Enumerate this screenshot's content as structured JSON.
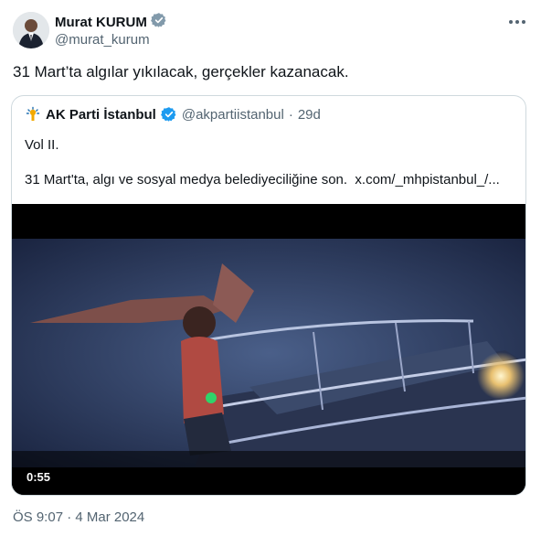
{
  "author": {
    "name": "Murat KURUM",
    "handle": "@murat_kurum",
    "verified_color": "#829aab"
  },
  "tweet": {
    "text": "31 Mart’ta algılar yıkılacak, gerçekler kazanacak.",
    "timestamp": "ÖS 9:07 · 4 Mar 2024"
  },
  "quote": {
    "name": "AK Parti İstanbul",
    "handle": "@akpartiistanbul",
    "separator": "·",
    "age": "29d",
    "text_line1": "Vol II.",
    "text_line2": "31 Mart'ta, algı ve sosyal medya belediyeciliğine son.",
    "link": "x.com/_mhpistanbul_/...",
    "verified_color": "#1d9bf0",
    "video_duration": "0:55"
  },
  "icons": {
    "more": "more-horizontal-icon",
    "verified": "verified-badge-icon",
    "logo": "ak-parti-logo-icon"
  }
}
